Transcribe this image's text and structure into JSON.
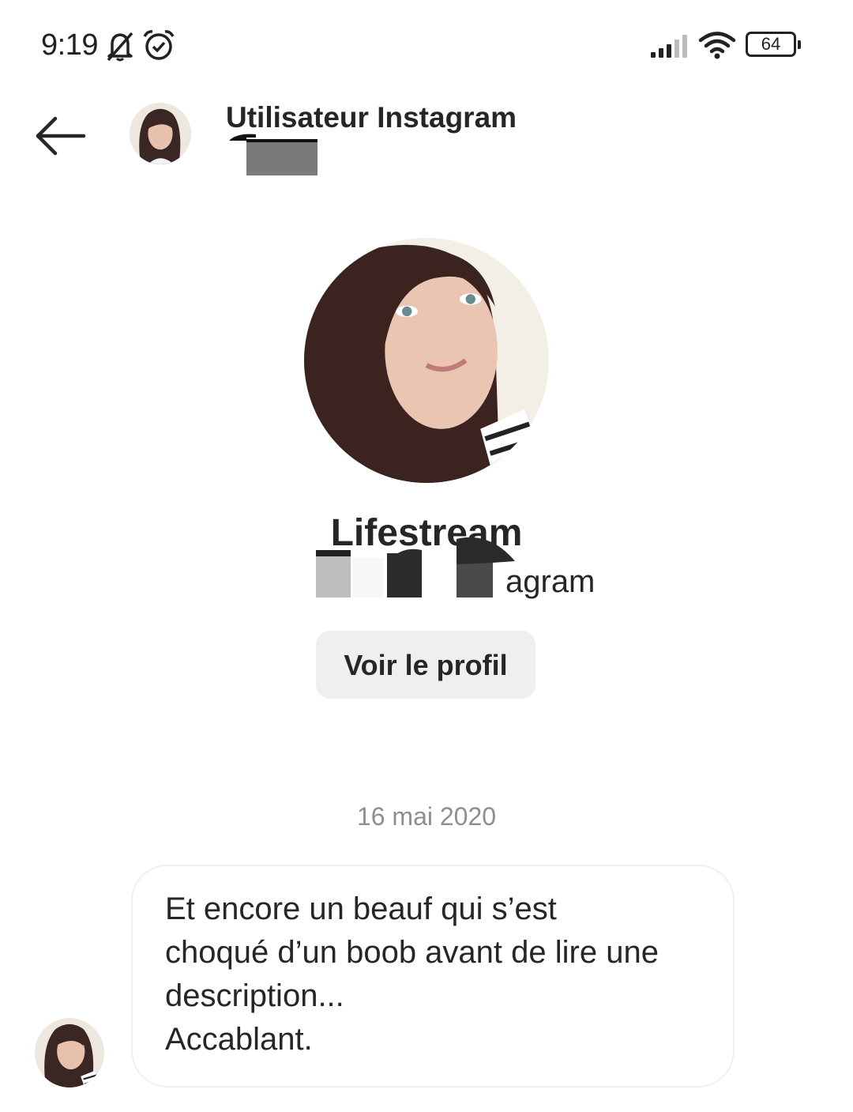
{
  "status_bar": {
    "time": "9:19",
    "battery": "64",
    "icons": [
      "bell-off-icon",
      "alarm-icon",
      "signal-icon",
      "wifi-icon",
      "battery-icon"
    ]
  },
  "header": {
    "title": "Utilisateur Instagram",
    "back_icon": "arrow-left-icon"
  },
  "profile": {
    "name": "Lifestream",
    "subtitle_visible_fragment": "agram",
    "view_profile_label": "Voir le profil"
  },
  "conversation": {
    "date": "16 mai 2020",
    "messages": [
      {
        "lines": [
          "Et encore un beauf qui s’est",
          "choqué d’un boob avant de lire une",
          "description...",
          "Accablant."
        ]
      }
    ]
  },
  "colors": {
    "text_primary": "#262626",
    "text_secondary": "#8e8e8e",
    "button_bg": "#efefef",
    "bubble_border": "#efefef"
  }
}
